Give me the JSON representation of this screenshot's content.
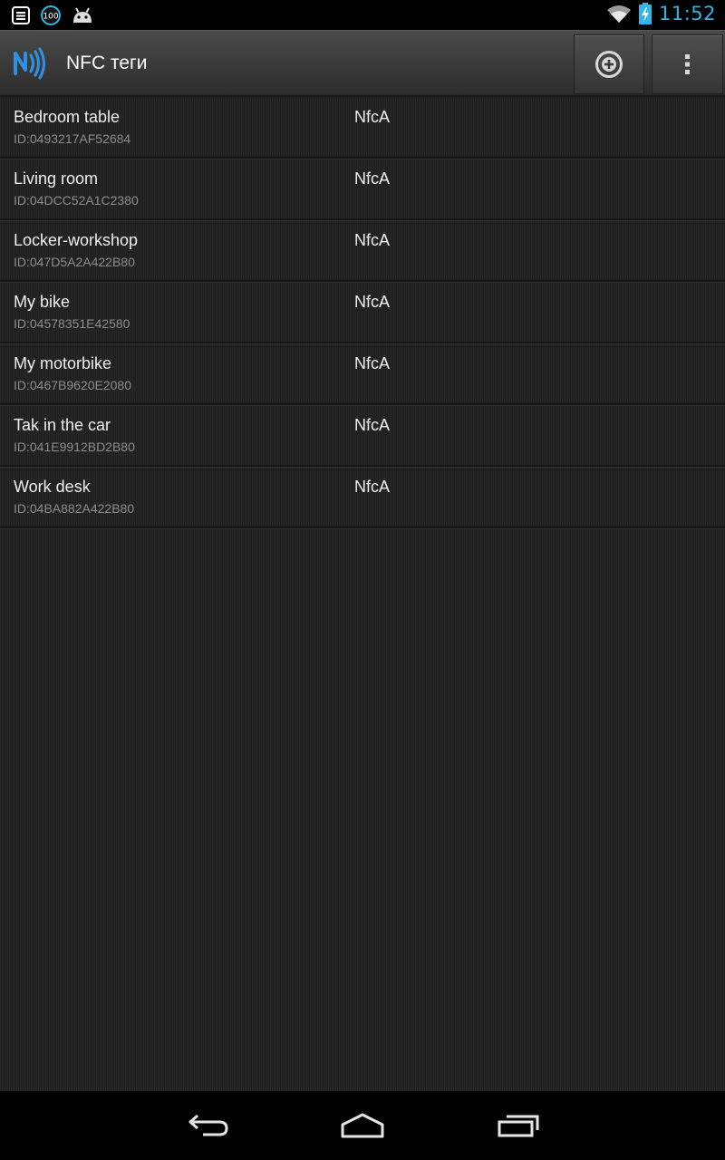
{
  "status_bar": {
    "time": "11:52",
    "battery_badge": "100",
    "icons": [
      "notes-icon",
      "battery-100-badge-icon",
      "android-icon",
      "wifi-icon",
      "battery-charging-icon"
    ]
  },
  "action_bar": {
    "title": "NFC теги",
    "app_icon": "nfc-icon",
    "add_icon": "add-circle-icon",
    "overflow_icon": "overflow-menu-icon"
  },
  "tags": [
    {
      "name": "Bedroom table",
      "id": "ID:0493217AF52684",
      "type": "NfcA"
    },
    {
      "name": "Living room",
      "id": "ID:04DCC52A1C2380",
      "type": "NfcA"
    },
    {
      "name": "Locker-workshop",
      "id": "ID:047D5A2A422B80",
      "type": "NfcA"
    },
    {
      "name": "My bike",
      "id": "ID:04578351E42580",
      "type": "NfcA"
    },
    {
      "name": "My motorbike",
      "id": "ID:0467B9620E2080",
      "type": "NfcA"
    },
    {
      "name": "Tak in the car",
      "id": "ID:041E9912BD2B80",
      "type": "NfcA"
    },
    {
      "name": "Work desk",
      "id": "ID:04BA882A422B80",
      "type": "NfcA"
    }
  ],
  "nav_bar": {
    "icons": [
      "back-icon",
      "home-icon",
      "recent-apps-icon"
    ]
  },
  "colors": {
    "accent": "#33b5e5",
    "nfc_blue": "#2f8fe0",
    "list_bg": "#222222"
  }
}
